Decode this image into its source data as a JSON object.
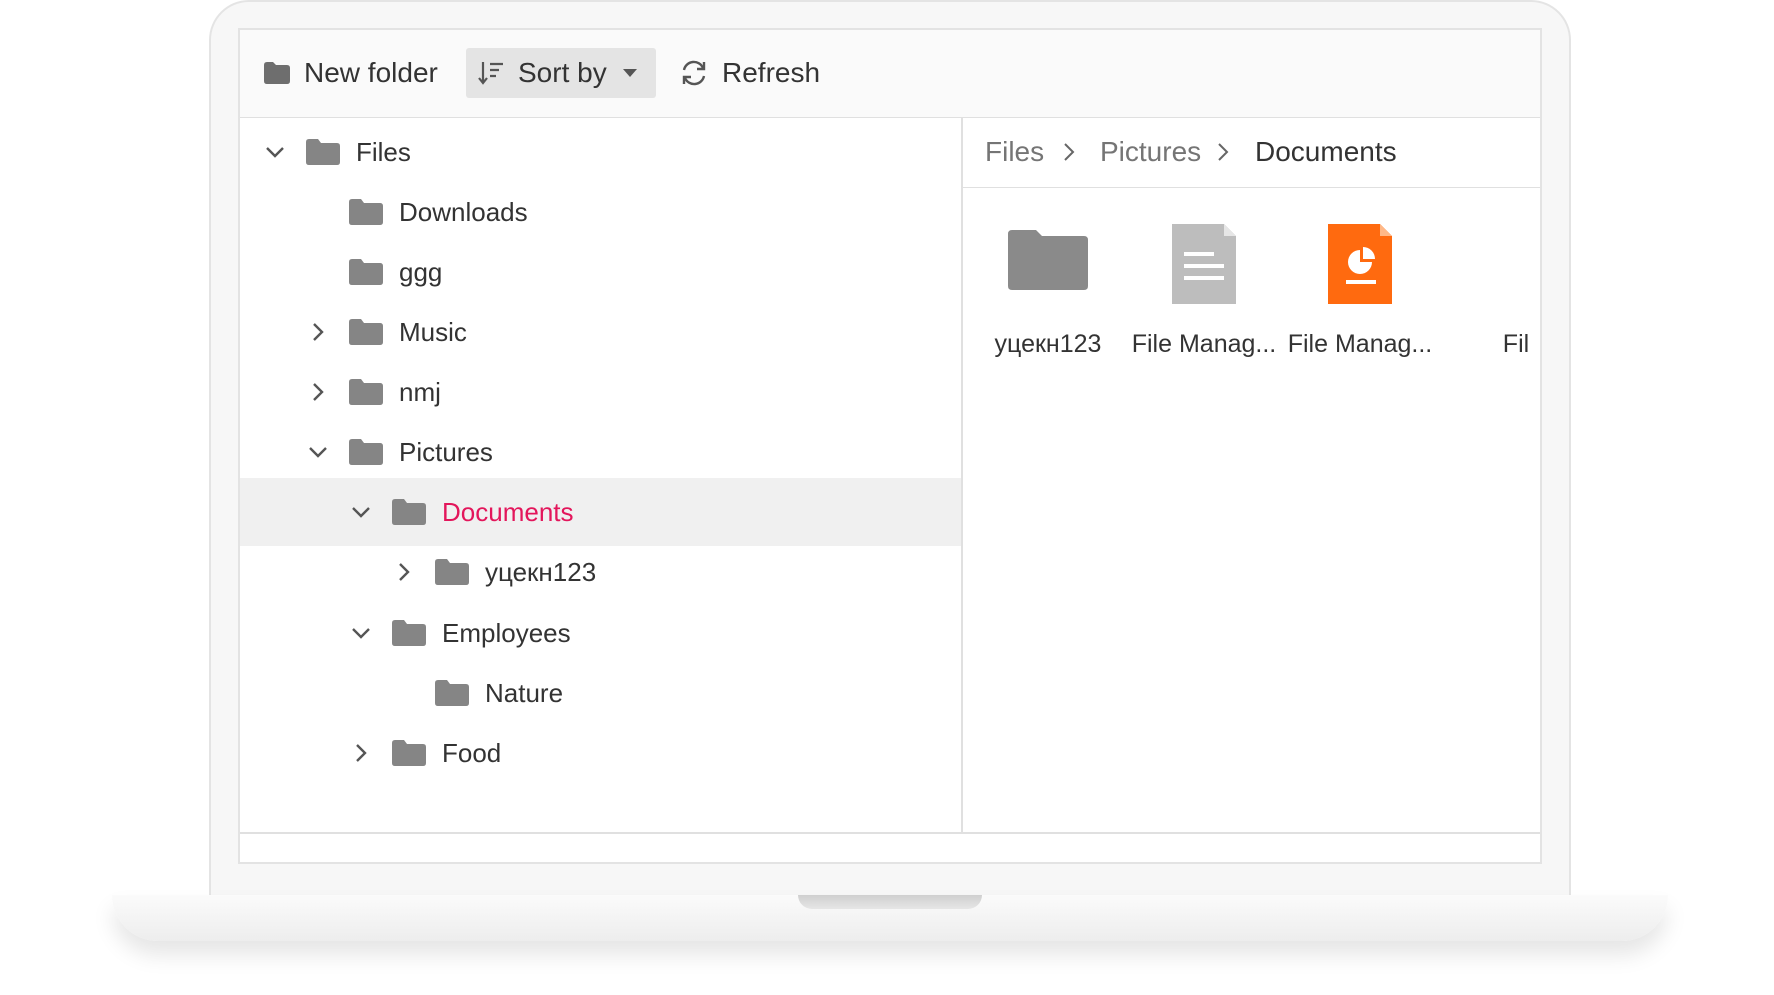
{
  "toolbar": {
    "new_folder": "New folder",
    "sort_by": "Sort by",
    "refresh": "Refresh"
  },
  "tree": {
    "root": "Files",
    "items": [
      {
        "label": "Downloads",
        "state": "leaf"
      },
      {
        "label": "ggg",
        "state": "leaf"
      },
      {
        "label": "Music",
        "state": "collapsed"
      },
      {
        "label": "nmj",
        "state": "collapsed"
      },
      {
        "label": "Pictures",
        "state": "expanded"
      },
      {
        "label": "Documents",
        "state": "expanded",
        "selected": true
      },
      {
        "label": "уцекн123",
        "state": "collapsed"
      },
      {
        "label": "Employees",
        "state": "expanded"
      },
      {
        "label": "Nature",
        "state": "leaf"
      },
      {
        "label": "Food",
        "state": "collapsed"
      }
    ]
  },
  "breadcrumb": [
    "Files",
    "Pictures",
    "Documents"
  ],
  "files": [
    {
      "name": "уцекн123",
      "icon": "folder-icon"
    },
    {
      "name": "File Manag...",
      "icon": "document-icon"
    },
    {
      "name": "File Manag...",
      "icon": "presentation-icon"
    },
    {
      "name": "Fil",
      "icon": "file-icon"
    }
  ],
  "colors": {
    "selected_text": "#e3165b",
    "folder_gray": "#858585",
    "presentation_orange": "#ff6a0f",
    "doc_gray": "#bdbdbd"
  }
}
